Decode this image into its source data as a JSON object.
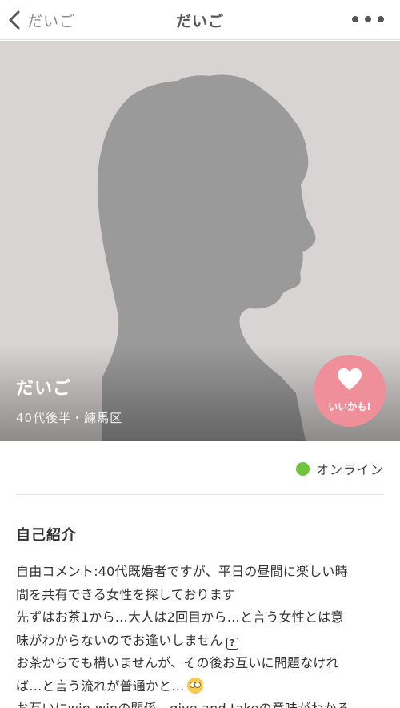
{
  "nav": {
    "back_label": "だいご",
    "title": "だいご",
    "back_icon": "chevron-left-icon",
    "more_icon": "more-horizontal-icon"
  },
  "profile": {
    "name": "だいご",
    "meta": "40代後半・練馬区",
    "photo_background": "#d7d4d3",
    "like": {
      "label": "いいかも!",
      "icon": "heart-icon",
      "color": "#ee8f9a"
    }
  },
  "status": {
    "label": "オンライン",
    "color": "#6fc43b"
  },
  "intro": {
    "title": "自己紹介",
    "lines": [
      "自由コメント:40代既婚者ですが、平日の昼間に楽しい時",
      "間を共有できる女性を探しております",
      "先ずはお茶1から…大人は2回目から…と言う女性とは意",
      "味がわからないのでお逢いしません",
      "お茶からでも構いませんが、その後お互いに問題なけれ",
      "ば…と言う流れが普通かと…",
      "お互いにwin-winの関係、give and takeの意味がわかる"
    ]
  }
}
